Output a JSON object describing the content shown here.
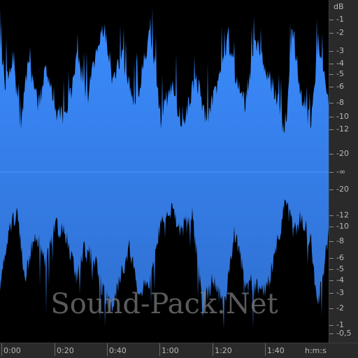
{
  "app": {
    "watermark_text": "Sound-Pack.Net"
  },
  "colors": {
    "waveform_top": "#3b8cff",
    "waveform_bottom": "#2f6fd0",
    "background": "#000000",
    "ruler_background": "#2a2a2a",
    "ruler_text": "#b8b8b8"
  },
  "db_ruler": {
    "unit_label": "dB",
    "labels": [
      "-1",
      "-2",
      "-3",
      "-4",
      "-5",
      "-6",
      "-8",
      "-10",
      "-12",
      "-20",
      "-∞",
      "-20",
      "-12",
      "-10",
      "-8",
      "-6",
      "-5",
      "-4",
      "-3",
      "-2",
      "-1",
      "-0,5"
    ]
  },
  "time_ruler": {
    "labels": [
      "0:00",
      "0:20",
      "0:40",
      "1:00",
      "1:20",
      "1:40"
    ],
    "unit_label": "h:m:s"
  }
}
